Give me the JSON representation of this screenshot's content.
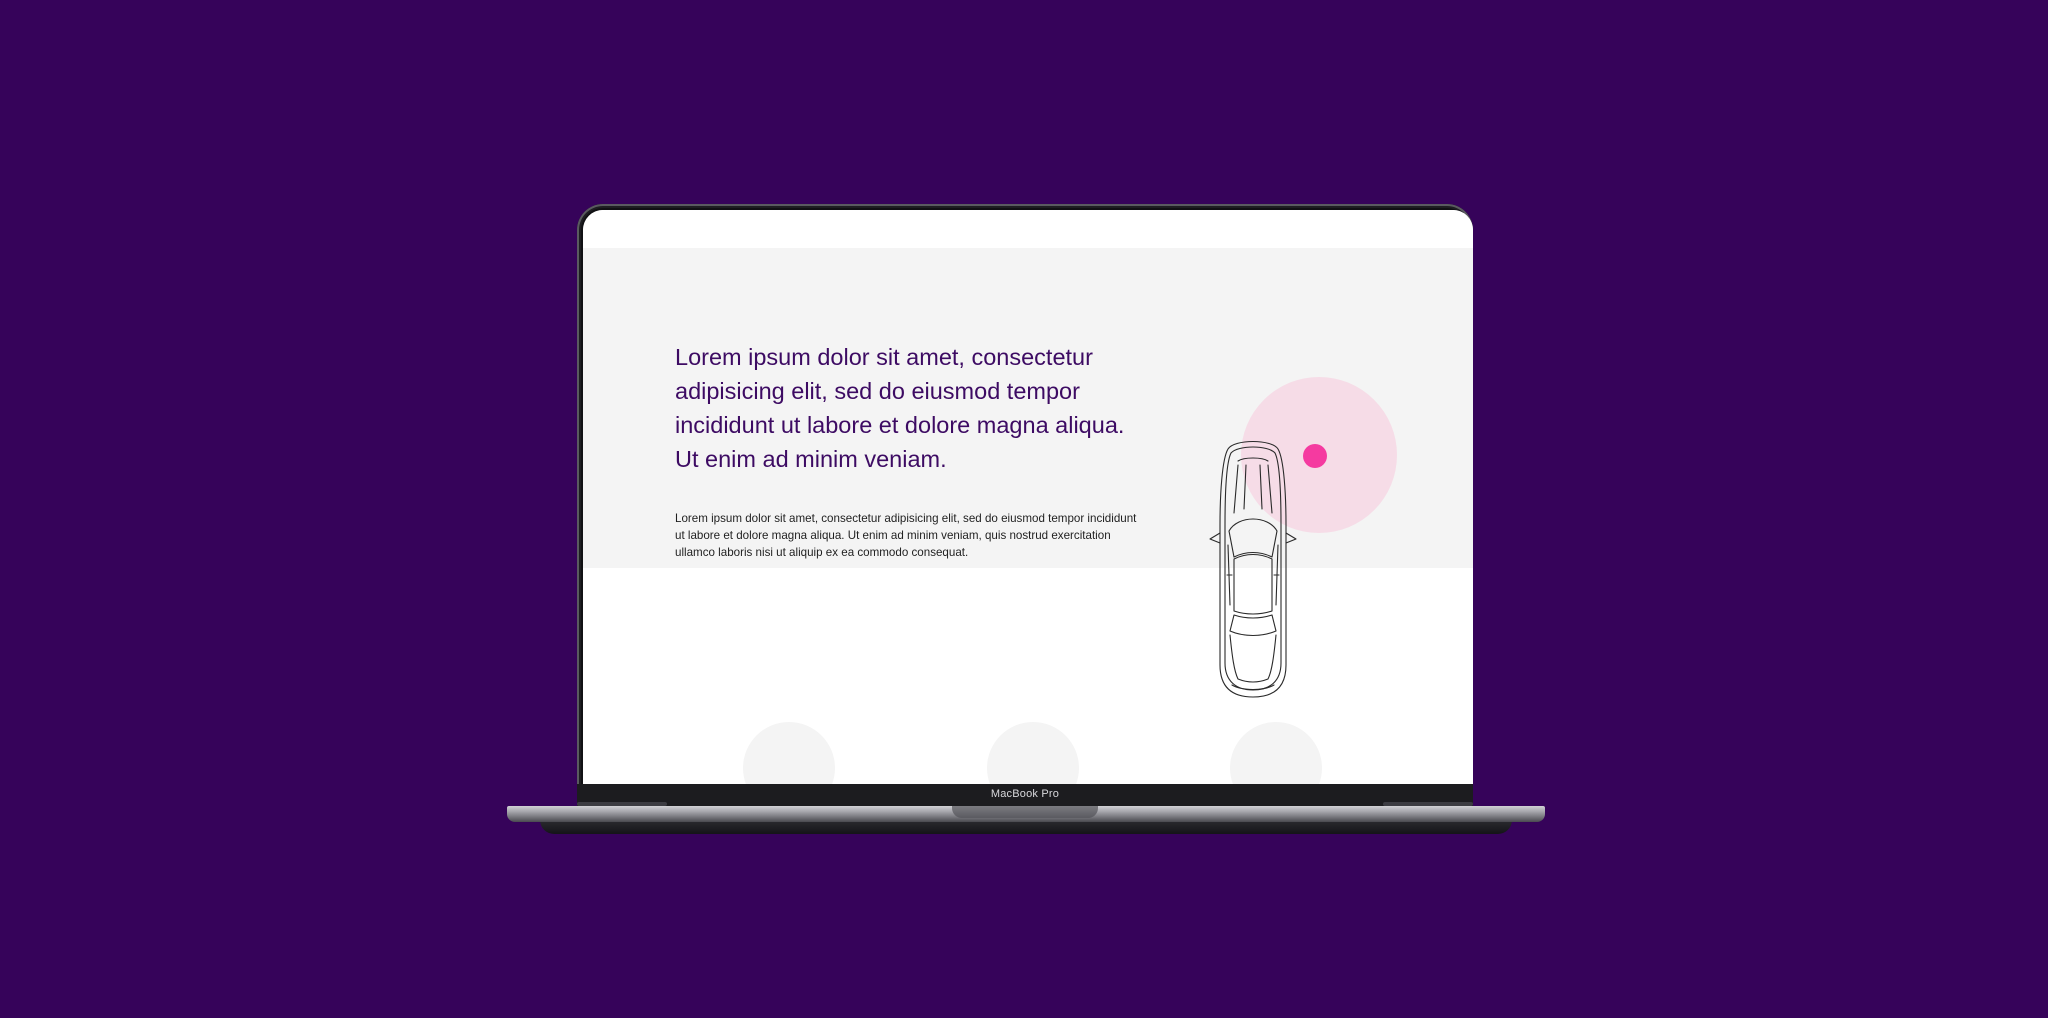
{
  "hero": {
    "headline": "Lorem ipsum dolor sit amet, consectetur adipisicing elit, sed do eiusmod tempor incididunt ut labore et dolore magna aliqua. Ut enim ad minim veniam.",
    "body": "Lorem ipsum dolor sit amet, consectetur adipisicing elit, sed do eiusmod tempor incididunt ut labore et dolore magna aliqua. Ut enim ad minim veniam, quis nostrud exercitation ullamco laboris nisi ut aliquip ex ea commodo consequat."
  },
  "device": {
    "model_label": "MacBook Pro"
  },
  "illustration": {
    "icon": "car-top-view-icon",
    "marker_color": "#f53aa0",
    "halo_color": "#f7cdde"
  },
  "colors": {
    "background": "#36035a",
    "headline": "#3d0b63",
    "hero_background": "#f4f4f4"
  }
}
